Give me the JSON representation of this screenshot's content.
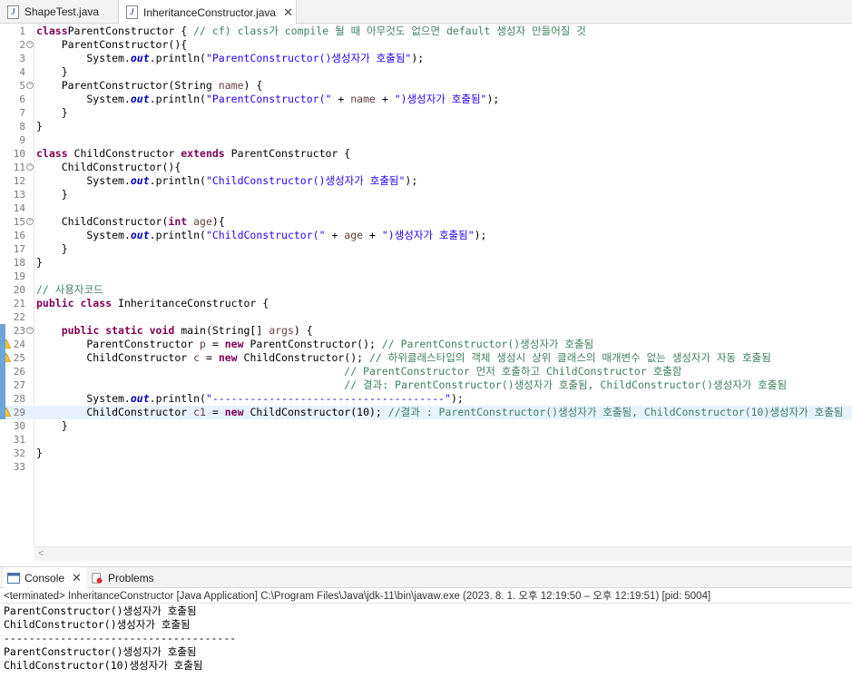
{
  "editor_tabs": [
    {
      "label": "ShapeTest.java",
      "active": false
    },
    {
      "label": "InheritanceConstructor.java",
      "active": true
    }
  ],
  "code_lines": [
    {
      "num": "1",
      "fold": false,
      "segs": [
        [
          "kw",
          "class"
        ],
        [
          "",
          "ParentConstructor { "
        ],
        [
          "cm",
          "// cf) class가 compile 될 때 아무것도 없으면 default 생성자 만들어질 것"
        ]
      ]
    },
    {
      "num": "2",
      "fold": true,
      "segs": [
        [
          "",
          "    ParentConstructor(){"
        ]
      ]
    },
    {
      "num": "3",
      "fold": false,
      "segs": [
        [
          "",
          "        System."
        ],
        [
          "fld",
          "out"
        ],
        [
          "",
          ".println("
        ],
        [
          "str",
          "\"ParentConstructor()생성자가 호출됨\""
        ],
        [
          "",
          ");"
        ]
      ]
    },
    {
      "num": "4",
      "fold": false,
      "segs": [
        [
          "",
          "    }"
        ]
      ]
    },
    {
      "num": "5",
      "fold": true,
      "segs": [
        [
          "",
          "    ParentConstructor(String "
        ],
        [
          "var",
          "name"
        ],
        [
          "",
          ") {"
        ]
      ]
    },
    {
      "num": "6",
      "fold": false,
      "segs": [
        [
          "",
          "        System."
        ],
        [
          "fld",
          "out"
        ],
        [
          "",
          ".println("
        ],
        [
          "str",
          "\"ParentConstructor(\""
        ],
        [
          "",
          " + "
        ],
        [
          "var",
          "name"
        ],
        [
          "",
          " + "
        ],
        [
          "str",
          "\")생성자가 호출됨\""
        ],
        [
          "",
          ");"
        ]
      ]
    },
    {
      "num": "7",
      "fold": false,
      "segs": [
        [
          "",
          "    }"
        ]
      ]
    },
    {
      "num": "8",
      "fold": false,
      "segs": [
        [
          "",
          "}"
        ]
      ]
    },
    {
      "num": "9",
      "fold": false,
      "segs": [
        [
          "",
          ""
        ]
      ]
    },
    {
      "num": "10",
      "fold": false,
      "segs": [
        [
          "kw",
          "class"
        ],
        [
          "",
          " ChildConstructor "
        ],
        [
          "kw",
          "extends"
        ],
        [
          "",
          " ParentConstructor {"
        ]
      ]
    },
    {
      "num": "11",
      "fold": true,
      "segs": [
        [
          "",
          "    ChildConstructor(){"
        ]
      ]
    },
    {
      "num": "12",
      "fold": false,
      "segs": [
        [
          "",
          "        System."
        ],
        [
          "fld",
          "out"
        ],
        [
          "",
          ".println("
        ],
        [
          "str",
          "\"ChildConstructor()생성자가 호출됨\""
        ],
        [
          "",
          ");"
        ]
      ]
    },
    {
      "num": "13",
      "fold": false,
      "segs": [
        [
          "",
          "    }"
        ]
      ]
    },
    {
      "num": "14",
      "fold": false,
      "segs": [
        [
          "",
          ""
        ]
      ]
    },
    {
      "num": "15",
      "fold": true,
      "segs": [
        [
          "",
          "    ChildConstructor("
        ],
        [
          "kw",
          "int"
        ],
        [
          "",
          " "
        ],
        [
          "var",
          "age"
        ],
        [
          "",
          "){"
        ]
      ]
    },
    {
      "num": "16",
      "fold": false,
      "segs": [
        [
          "",
          "        System."
        ],
        [
          "fld",
          "out"
        ],
        [
          "",
          ".println("
        ],
        [
          "str",
          "\"ChildConstructor(\""
        ],
        [
          "",
          " + "
        ],
        [
          "var",
          "age"
        ],
        [
          "",
          " + "
        ],
        [
          "str",
          "\")생성자가 호출됨\""
        ],
        [
          "",
          ");"
        ]
      ]
    },
    {
      "num": "17",
      "fold": false,
      "segs": [
        [
          "",
          "    }"
        ]
      ]
    },
    {
      "num": "18",
      "fold": false,
      "segs": [
        [
          "",
          "}"
        ]
      ]
    },
    {
      "num": "19",
      "fold": false,
      "segs": [
        [
          "",
          ""
        ]
      ]
    },
    {
      "num": "20",
      "fold": false,
      "segs": [
        [
          "cm",
          "// 사용자코드"
        ]
      ]
    },
    {
      "num": "21",
      "fold": false,
      "segs": [
        [
          "kw",
          "public class"
        ],
        [
          "",
          " InheritanceConstructor {"
        ]
      ]
    },
    {
      "num": "22",
      "fold": false,
      "segs": [
        [
          "",
          ""
        ]
      ]
    },
    {
      "num": "23",
      "fold": true,
      "segs": [
        [
          "",
          "    "
        ],
        [
          "kw",
          "public static void"
        ],
        [
          "",
          " main(String[] "
        ],
        [
          "var",
          "args"
        ],
        [
          "",
          ") {"
        ]
      ]
    },
    {
      "num": "24",
      "fold": false,
      "warn": true,
      "segs": [
        [
          "",
          "        ParentConstructor "
        ],
        [
          "var",
          "p"
        ],
        [
          "",
          " = "
        ],
        [
          "kw",
          "new"
        ],
        [
          "",
          " ParentConstructor(); "
        ],
        [
          "cm",
          "// ParentConstructor()생성자가 호출됨"
        ]
      ]
    },
    {
      "num": "25",
      "fold": false,
      "warn": true,
      "segs": [
        [
          "",
          "        ChildConstructor "
        ],
        [
          "var",
          "c"
        ],
        [
          "",
          " = "
        ],
        [
          "kw",
          "new"
        ],
        [
          "",
          " ChildConstructor(); "
        ],
        [
          "cm",
          "// 하위클래스타입의 객체 생성시 상위 클래스의 매개변수 없는 생성자가 자동 호출됨"
        ]
      ]
    },
    {
      "num": "26",
      "fold": false,
      "segs": [
        [
          "",
          "                                                 "
        ],
        [
          "cm",
          "// ParentConstructor 먼저 호출하고 ChildConstructor 호출함"
        ]
      ]
    },
    {
      "num": "27",
      "fold": false,
      "segs": [
        [
          "",
          "                                                 "
        ],
        [
          "cm",
          "// 결과: ParentConstructor()생성자가 호출됨, ChildConstructor()생성자가 호출됨"
        ]
      ]
    },
    {
      "num": "28",
      "fold": false,
      "segs": [
        [
          "",
          "        System."
        ],
        [
          "fld",
          "out"
        ],
        [
          "",
          ".println("
        ],
        [
          "str",
          "\"-------------------------------------\""
        ],
        [
          "",
          ");"
        ]
      ]
    },
    {
      "num": "29",
      "fold": false,
      "warn": true,
      "hl": true,
      "segs": [
        [
          "",
          "        ChildConstructor "
        ],
        [
          "var",
          "c1"
        ],
        [
          "",
          " = "
        ],
        [
          "kw",
          "new"
        ],
        [
          "",
          " ChildConstructor(10); "
        ],
        [
          "cm",
          "//결과 : ParentConstructor()생성자가 호출됨, ChildConstructor(10)생성자가 호출됨"
        ]
      ]
    },
    {
      "num": "30",
      "fold": false,
      "segs": [
        [
          "",
          "    }"
        ]
      ]
    },
    {
      "num": "31",
      "fold": false,
      "segs": [
        [
          "",
          ""
        ]
      ]
    },
    {
      "num": "32",
      "fold": false,
      "segs": [
        [
          "",
          "}"
        ]
      ]
    },
    {
      "num": "33",
      "fold": false,
      "segs": [
        [
          "",
          ""
        ]
      ]
    }
  ],
  "panel": {
    "console_label": "Console",
    "problems_label": "Problems",
    "status": "<terminated> InheritanceConstructor [Java Application] C:\\Program Files\\Java\\jdk-11\\bin\\javaw.exe  (2023. 8. 1. 오후 12:19:50 – 오후 12:19:51) [pid: 5004]",
    "output": [
      "ParentConstructor()생성자가 호출됨",
      "ChildConstructor()생성자가 호출됨",
      "-------------------------------------",
      "ParentConstructor()생성자가 호출됨",
      "ChildConstructor(10)생성자가 호출됨"
    ]
  },
  "colors": {
    "keyword": "#7f0055",
    "string": "#2a00ff",
    "comment": "#3f7f5f",
    "highlight_line": "#e8f2fe"
  }
}
